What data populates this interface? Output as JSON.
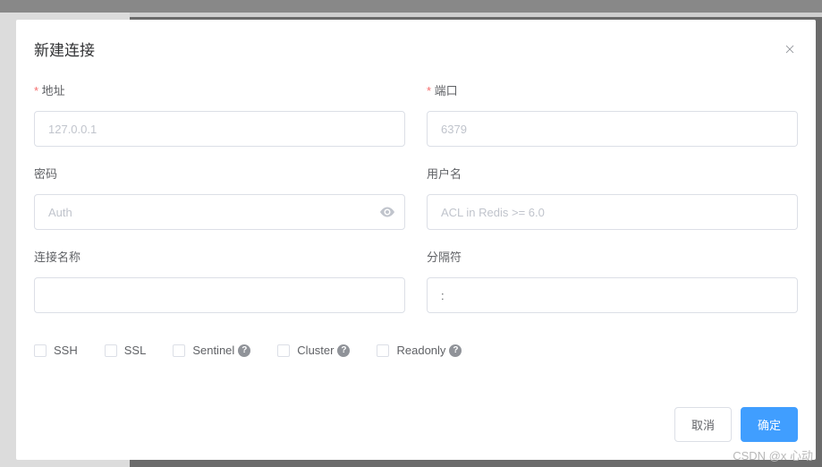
{
  "dialog": {
    "title": "新建连接"
  },
  "form": {
    "address": {
      "label": "地址",
      "placeholder": "127.0.0.1"
    },
    "port": {
      "label": "端口",
      "placeholder": "6379"
    },
    "password": {
      "label": "密码",
      "placeholder": "Auth"
    },
    "username": {
      "label": "用户名",
      "placeholder": "ACL in Redis >= 6.0"
    },
    "connectionName": {
      "label": "连接名称"
    },
    "separator": {
      "label": "分隔符",
      "value": ":"
    }
  },
  "checkboxes": {
    "ssh": "SSH",
    "ssl": "SSL",
    "sentinel": "Sentinel",
    "cluster": "Cluster",
    "readonly": "Readonly"
  },
  "footer": {
    "cancel": "取消",
    "confirm": "确定"
  },
  "watermark": "CSDN @x 心动"
}
